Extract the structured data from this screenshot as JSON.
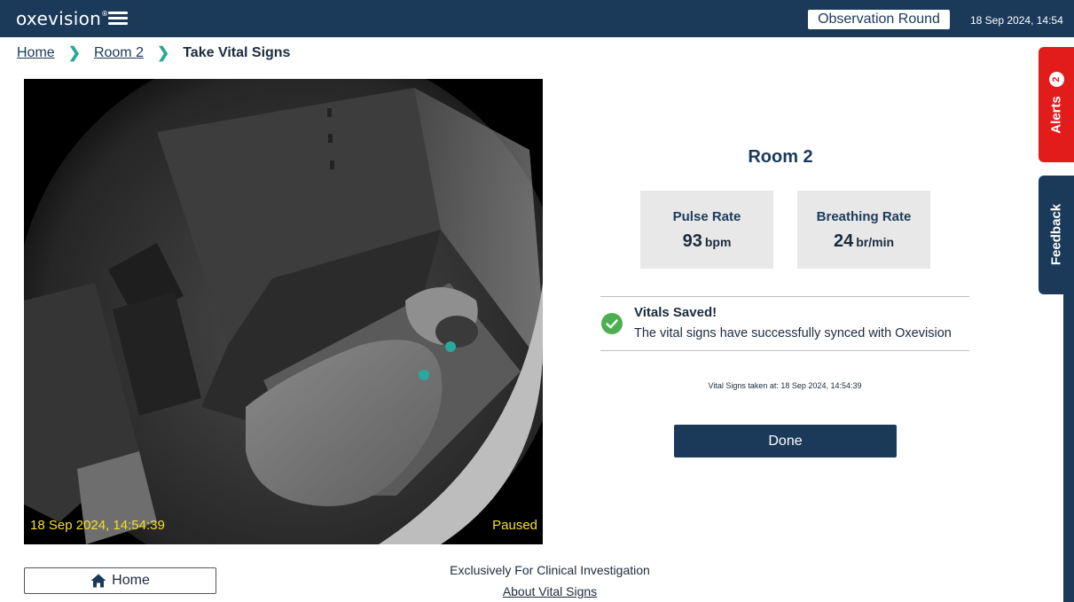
{
  "app": {
    "logo_text": "oxevision",
    "logo_mark": "®",
    "observation_round_label": "Observation Round",
    "datetime": "18 Sep 2024, 14:54"
  },
  "breadcrumb": {
    "home": "Home",
    "room": "Room 2",
    "current": "Take Vital Signs"
  },
  "camera": {
    "timestamp": "18 Sep 2024, 14:54:39",
    "status": "Paused"
  },
  "vitals": {
    "room_title": "Room 2",
    "pulse": {
      "label": "Pulse Rate",
      "value": "93",
      "unit": "bpm"
    },
    "breathing": {
      "label": "Breathing Rate",
      "value": "24",
      "unit": "br/min"
    },
    "saved_title": "Vitals Saved!",
    "saved_message": "The vital signs have successfully synced with Oxevision",
    "taken_at": "Vital Signs taken at: 18 Sep 2024, 14:54:39",
    "done_label": "Done"
  },
  "footer": {
    "home_label": "Home",
    "exclusive_text": "Exclusively For Clinical Investigation",
    "about_link": "About Vital Signs"
  },
  "side_tabs": {
    "alerts_label": "Alerts",
    "alerts_count": "2",
    "feedback_label": "Feedback"
  },
  "colors": {
    "navy": "#1b3a5a",
    "alert_red": "#e21b1b",
    "success_green": "#4caf50",
    "overlay_yellow": "#f2e02a",
    "breadcrumb_chevron": "#29a89a"
  }
}
